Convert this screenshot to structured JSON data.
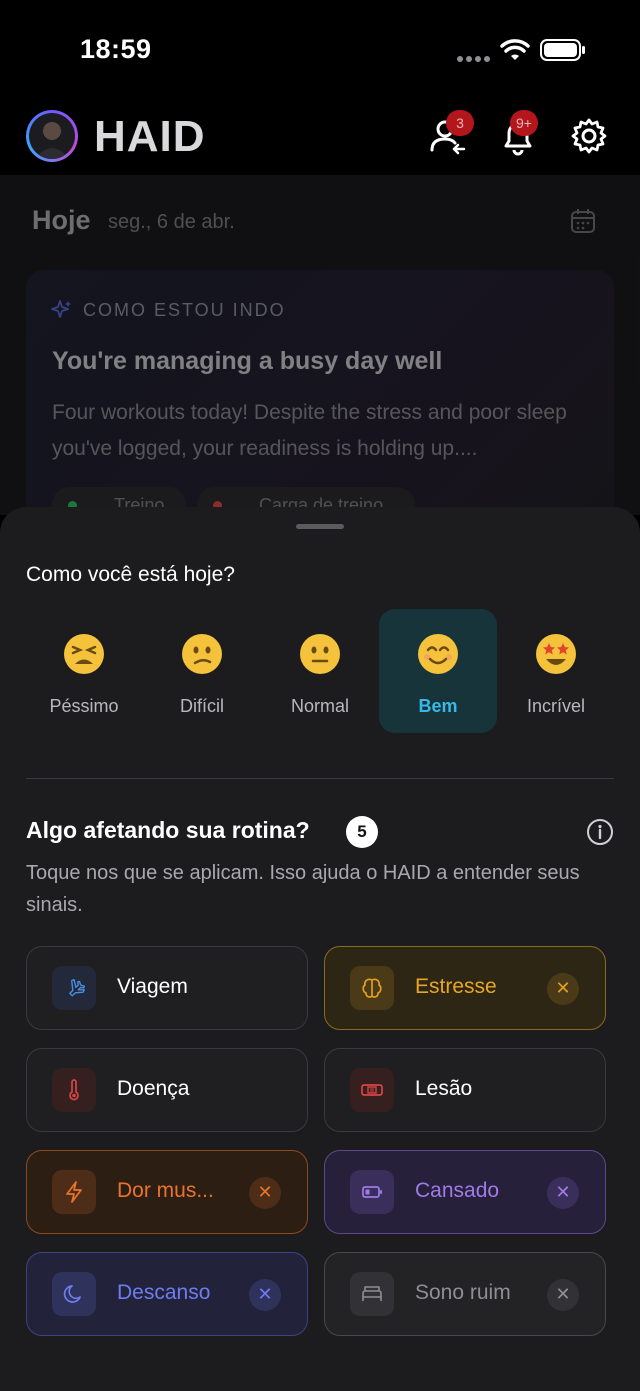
{
  "status_bar": {
    "time": "18:59"
  },
  "header": {
    "brand": "HAID",
    "friends_badge": "3",
    "notifications_badge": "9+"
  },
  "today": {
    "title": "Hoje",
    "date": "seg., 6 de abr."
  },
  "insight_card": {
    "kicker": "COMO ESTOU INDO",
    "title": "You're managing a busy day well",
    "body": "Four workouts today! Despite the stress and poor sleep you've logged, your readiness is holding up....",
    "chips": [
      {
        "label": "Treino",
        "dot_color": "#2fb562"
      },
      {
        "label": "Carga de treino",
        "dot_color": "#d64545"
      }
    ]
  },
  "mood_question": "Como você está hoje?",
  "moods": [
    {
      "label": "Péssimo",
      "emoji": "😫",
      "selected": false
    },
    {
      "label": "Difícil",
      "emoji": "😕",
      "selected": false
    },
    {
      "label": "Normal",
      "emoji": "😐",
      "selected": false
    },
    {
      "label": "Bem",
      "emoji": "😊",
      "selected": true
    },
    {
      "label": "Incrível",
      "emoji": "🤩",
      "selected": false
    }
  ],
  "factors": {
    "title": "Algo afetando sua rotina?",
    "count": "5",
    "subtitle": "Toque nos que se aplicam. Isso ajuda o HAID a entender seus sinais.",
    "items": [
      {
        "label": "Viagem",
        "icon": "plane-icon",
        "active": false,
        "color": "#4a90e2"
      },
      {
        "label": "Estresse",
        "icon": "brain-icon",
        "active": true,
        "color": "#e0a020"
      },
      {
        "label": "Doença",
        "icon": "thermometer-icon",
        "active": false,
        "color": "#d64545"
      },
      {
        "label": "Lesão",
        "icon": "bandage-icon",
        "active": false,
        "color": "#d64545"
      },
      {
        "label": "Dor mus...",
        "icon": "lightning-icon",
        "active": true,
        "color": "#e8742c"
      },
      {
        "label": "Cansado",
        "icon": "battery-low-icon",
        "active": true,
        "color": "#a07be8"
      },
      {
        "label": "Descanso",
        "icon": "moon-icon",
        "active": true,
        "color": "#6f7cf0"
      },
      {
        "label": "Sono ruim",
        "icon": "bed-icon",
        "active": true,
        "color": "#8e8e93"
      }
    ]
  }
}
